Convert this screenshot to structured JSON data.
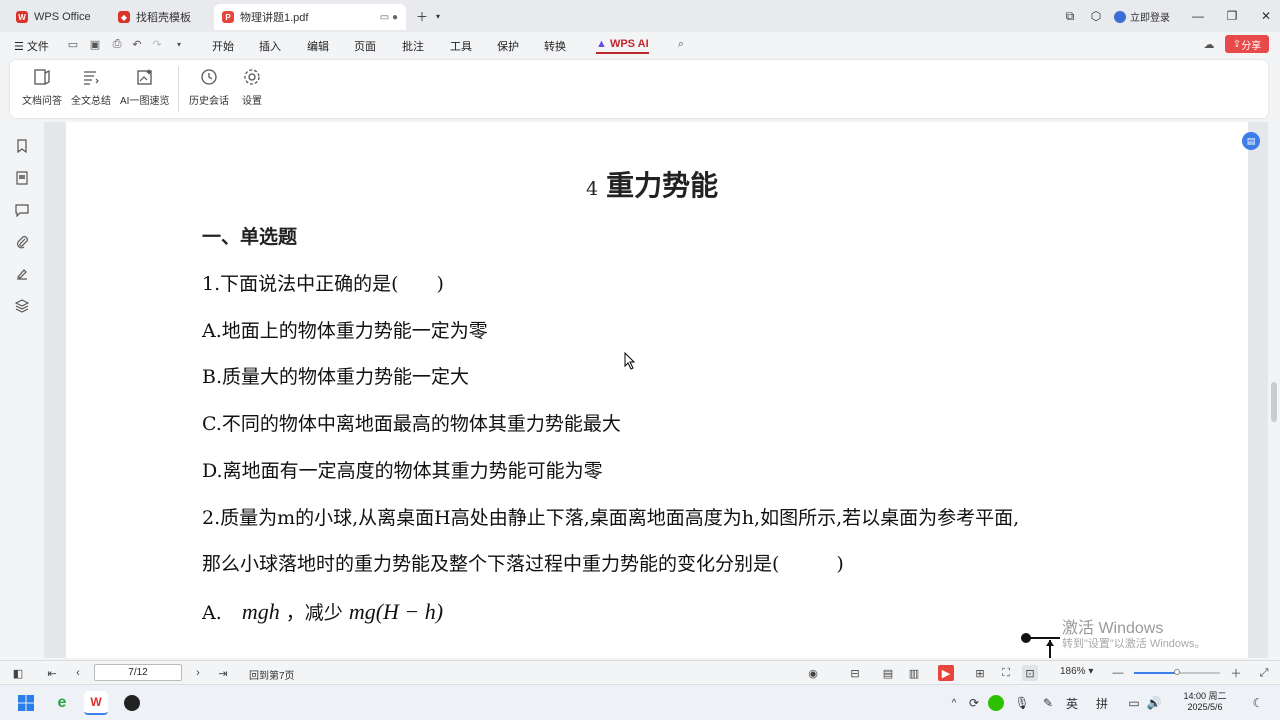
{
  "tabs": [
    {
      "label": "WPS Office",
      "icon": "wps-logo",
      "color": "#d9342b"
    },
    {
      "label": "找稻壳模板",
      "icon": "docer-icon",
      "color": "#d9342b"
    },
    {
      "label": "物理讲题1.pdf",
      "icon": "pdf-icon",
      "color": "#e8453c"
    }
  ],
  "login_label": "立即登录",
  "menu": {
    "file": "文件",
    "items": [
      "开始",
      "插入",
      "编辑",
      "页面",
      "批注",
      "工具",
      "保护",
      "转换"
    ],
    "ai": "WPS AI",
    "share": "分享"
  },
  "ribbon": [
    {
      "label": "文档问答",
      "icon": "doc-qa-icon"
    },
    {
      "label": "全文总结",
      "icon": "summary-icon"
    },
    {
      "label": "AI一图速览",
      "icon": "ai-image-icon"
    },
    {
      "label": "历史会话",
      "icon": "history-icon"
    },
    {
      "label": "设置",
      "icon": "settings-icon"
    }
  ],
  "document": {
    "title_number": "4",
    "title_text": "重力势能",
    "section": "一、单选题",
    "lines": [
      "1.下面说法中正确的是(　　)",
      "A.地面上的物体重力势能一定为零",
      "B.质量大的物体重力势能一定大",
      "C.不同的物体中离地面最高的物体其重力势能最大",
      "D.离地面有一定高度的物体其重力势能可能为零",
      "2.质量为m的小球,从离桌面H高处由静止下落,桌面离地面高度为h,如图所示,若以桌面为参考平面,",
      "那么小球落地时的重力势能及整个下落过程中重力势能的变化分别是(　　　)"
    ],
    "option_a_prefix": "A.",
    "option_a_math1": "mgh",
    "option_a_sep": "，减少",
    "option_a_math2": "mg(H − h)"
  },
  "status": {
    "page_input": "7/12",
    "back_label": "回到第7页",
    "zoom": "186%"
  },
  "watermark": {
    "line1": "激活 Windows",
    "line2": "转到\"设置\"以激活 Windows。"
  },
  "taskbar": {
    "ime1": "英",
    "ime2": "拼",
    "time": "14:00 周二",
    "date": "2025/5/6"
  }
}
